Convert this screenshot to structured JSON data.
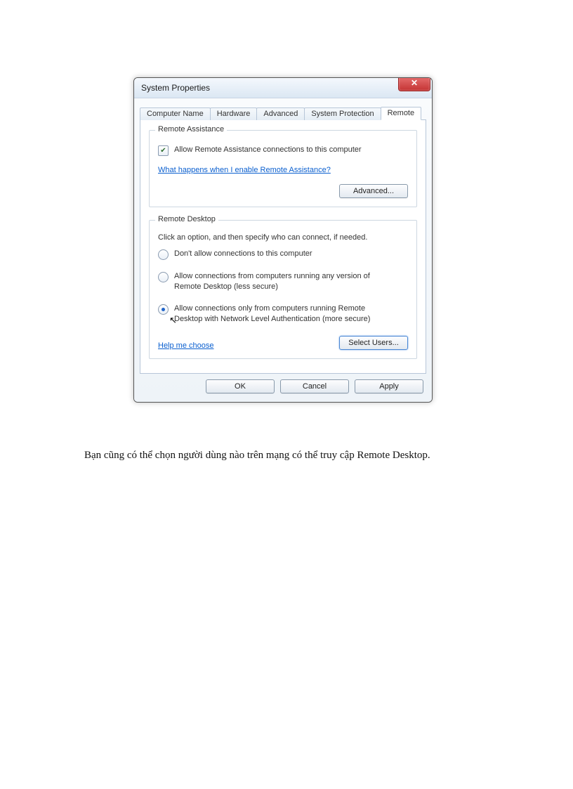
{
  "dialog": {
    "title": "System Properties",
    "close_glyph": "✕",
    "tabs": [
      "Computer Name",
      "Hardware",
      "Advanced",
      "System Protection",
      "Remote"
    ],
    "active_tab_index": 4,
    "group_assist": {
      "title": "Remote Assistance",
      "checkbox_label": "Allow Remote Assistance connections to this computer",
      "checkbox_checked": true,
      "link": "What happens when I enable Remote Assistance?",
      "advanced_btn": "Advanced..."
    },
    "group_desktop": {
      "title": "Remote Desktop",
      "instruction": "Click an option, and then specify who can connect, if needed.",
      "radios": [
        {
          "label": "Don't allow connections to this computer",
          "selected": false
        },
        {
          "label": "Allow connections from computers running any version of Remote Desktop (less secure)",
          "selected": false
        },
        {
          "label": "Allow connections only from computers running Remote Desktop with Network Level Authentication (more secure)",
          "selected": true
        }
      ],
      "help_link": "Help me choose",
      "select_users_btn": "Select Users..."
    },
    "buttons": {
      "ok": "OK",
      "cancel": "Cancel",
      "apply": "Apply"
    }
  },
  "caption": "Bạn cũng có thể chọn người dùng nào trên mạng có thể truy cập Remote Desktop."
}
